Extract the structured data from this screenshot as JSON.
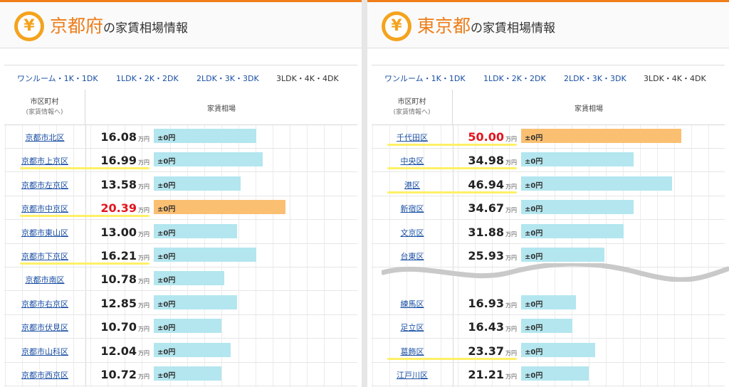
{
  "left": {
    "icon": "¥",
    "pref": "京都府",
    "title_suffix": "の家賃相場情報",
    "tabs": [
      "ワンルーム・1K・1DK",
      "1LDK・2K・2DK",
      "2LDK・3K・3DK",
      "3LDK・4K・4DK"
    ],
    "active_tab": 3,
    "col_name_line1": "市区町村",
    "col_name_line2": "(家賃情報へ)",
    "col_rent": "家賃相場",
    "unit": "万円",
    "rows": [
      {
        "name": "京都市北区",
        "price": "16.08",
        "delta": "±0円",
        "bar_fraction": 0.32,
        "highlight": false,
        "underline": false
      },
      {
        "name": "京都市上京区",
        "price": "16.99",
        "delta": "±0円",
        "bar_fraction": 0.34,
        "highlight": false,
        "underline": true
      },
      {
        "name": "京都市左京区",
        "price": "13.58",
        "delta": "±0円",
        "bar_fraction": 0.27,
        "highlight": false,
        "underline": false
      },
      {
        "name": "京都市中京区",
        "price": "20.39",
        "delta": "±0円",
        "bar_fraction": 0.41,
        "highlight": true,
        "underline": true
      },
      {
        "name": "京都市東山区",
        "price": "13.00",
        "delta": "±0円",
        "bar_fraction": 0.26,
        "highlight": false,
        "underline": false
      },
      {
        "name": "京都市下京区",
        "price": "16.21",
        "delta": "±0円",
        "bar_fraction": 0.32,
        "highlight": false,
        "underline": true
      },
      {
        "name": "京都市南区",
        "price": "10.78",
        "delta": "±0円",
        "bar_fraction": 0.22,
        "highlight": false,
        "underline": false
      },
      {
        "name": "京都市右京区",
        "price": "12.85",
        "delta": "±0円",
        "bar_fraction": 0.26,
        "highlight": false,
        "underline": false
      },
      {
        "name": "京都市伏見区",
        "price": "10.70",
        "delta": "±0円",
        "bar_fraction": 0.21,
        "highlight": false,
        "underline": false
      },
      {
        "name": "京都市山科区",
        "price": "12.04",
        "delta": "±0円",
        "bar_fraction": 0.24,
        "highlight": false,
        "underline": false
      },
      {
        "name": "京都市西京区",
        "price": "10.72",
        "delta": "±0円",
        "bar_fraction": 0.21,
        "highlight": false,
        "underline": false
      }
    ]
  },
  "right": {
    "icon": "¥",
    "pref": "東京都",
    "title_suffix": "の家賃相場情報",
    "tabs": [
      "ワンルーム・1K・1DK",
      "1LDK・2K・2DK",
      "2LDK・3K・3DK",
      "3LDK・4K・4DK"
    ],
    "active_tab": 3,
    "col_name_line1": "市区町村",
    "col_name_line2": "(家賃情報へ)",
    "col_rent": "家賃相場",
    "unit": "万円",
    "rows": [
      {
        "name": "千代田区",
        "price": "50.00",
        "delta": "±0円",
        "bar_fraction": 0.5,
        "highlight": true,
        "underline": true
      },
      {
        "name": "中央区",
        "price": "34.98",
        "delta": "±0円",
        "bar_fraction": 0.35,
        "highlight": false,
        "underline": true
      },
      {
        "name": "港区",
        "price": "46.94",
        "delta": "±0円",
        "bar_fraction": 0.47,
        "highlight": false,
        "underline": true
      },
      {
        "name": "新宿区",
        "price": "34.67",
        "delta": "±0円",
        "bar_fraction": 0.35,
        "highlight": false,
        "underline": false
      },
      {
        "name": "文京区",
        "price": "31.88",
        "delta": "±0円",
        "bar_fraction": 0.32,
        "highlight": false,
        "underline": false
      },
      {
        "name": "台東区",
        "price": "25.93",
        "delta": "±0円",
        "bar_fraction": 0.26,
        "highlight": false,
        "underline": false
      },
      {
        "name": "練馬区",
        "price": "16.93",
        "delta": "±0円",
        "bar_fraction": 0.17,
        "highlight": false,
        "underline": false
      },
      {
        "name": "足立区",
        "price": "16.43",
        "delta": "±0円",
        "bar_fraction": 0.16,
        "highlight": false,
        "underline": false
      },
      {
        "name": "葛飾区",
        "price": "23.37",
        "delta": "±0円",
        "bar_fraction": 0.23,
        "highlight": false,
        "underline": true
      },
      {
        "name": "江戸川区",
        "price": "21.21",
        "delta": "±0円",
        "bar_fraction": 0.21,
        "highlight": false,
        "underline": false
      }
    ],
    "gap_after_row": 5
  }
}
